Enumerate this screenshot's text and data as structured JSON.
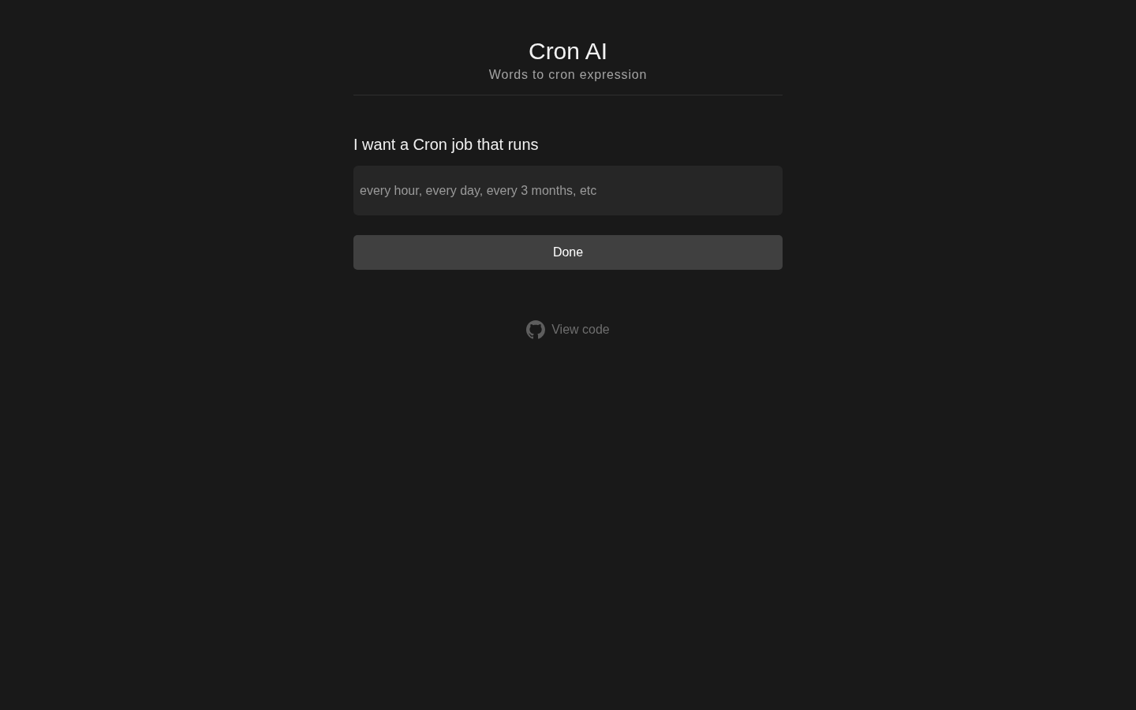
{
  "header": {
    "title": "Cron AI",
    "subtitle": "Words to cron expression"
  },
  "form": {
    "label": "I want a Cron job that runs",
    "input": {
      "placeholder": "every hour, every day, every 3 months, etc"
    },
    "button": "Done"
  },
  "footer": {
    "link": "View code"
  }
}
